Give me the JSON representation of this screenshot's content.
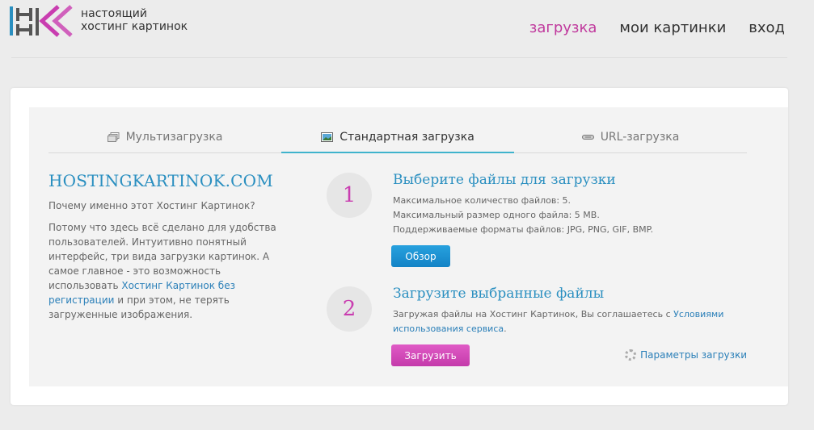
{
  "header": {
    "tagline_line1": "настоящий",
    "tagline_line2": "хостинг картинок",
    "nav": [
      {
        "label": "загрузка",
        "active": true
      },
      {
        "label": "мои картинки",
        "active": false
      },
      {
        "label": "вход",
        "active": false
      }
    ]
  },
  "tabs": [
    {
      "label": "Мультизагрузка",
      "icon": "multi-upload-icon"
    },
    {
      "label": "Стандартная загрузка",
      "icon": "image-icon",
      "active": true
    },
    {
      "label": "URL-загрузка",
      "icon": "link-icon"
    }
  ],
  "left": {
    "title": "HOSTINGKARTINOK.COM",
    "question": "Почему именно этот Хостинг Картинок?",
    "desc_part1": "Потому что здесь всё сделано для удобства пользователей. Интуитивно понятный интерфейс, три вида загрузки картинок. А самое главное - это возможность использовать ",
    "desc_link": "Хостинг Картинок без регистрации",
    "desc_part2": " и при этом, не терять загруженные изображения."
  },
  "step1": {
    "number": "1",
    "title": "Выберите файлы для загрузки",
    "info1": "Максимальное количество файлов: 5.",
    "info2": "Максимальный размер одного файла: 5 MB.",
    "info3": "Поддерживаемые форматы файлов: JPG, PNG, GIF, BMP.",
    "button": "Обзор"
  },
  "step2": {
    "number": "2",
    "title": "Загрузите выбранные файлы",
    "info_part1": "Загружая файлы на Хостинг Картинок, Вы соглашаетесь с ",
    "info_link": "Условиями использования сервиса",
    "info_part2": ".",
    "button": "Загрузить"
  },
  "params_link": "Параметры загрузки",
  "colors": {
    "accent_blue": "#2a8fc0",
    "accent_pink": "#c93db0",
    "tab_underline": "#3fb3cc"
  }
}
